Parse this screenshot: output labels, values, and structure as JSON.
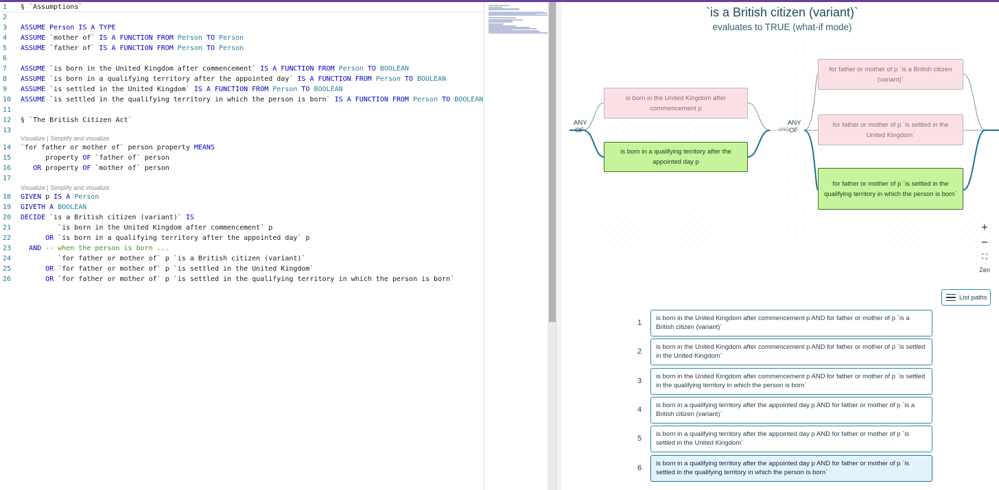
{
  "editor": {
    "lines": [
      {
        "n": "1",
        "tokens": [
          {
            "t": "§ `Assumptions`",
            "c": ""
          }
        ]
      },
      {
        "n": "2",
        "tokens": []
      },
      {
        "n": "3",
        "tokens": [
          {
            "t": "ASSUME Person ",
            "c": "kw"
          },
          {
            "t": "IS A TYPE",
            "c": "kw"
          }
        ]
      },
      {
        "n": "4",
        "tokens": [
          {
            "t": "ASSUME ",
            "c": "kw"
          },
          {
            "t": "`mother of` ",
            "c": ""
          },
          {
            "t": "IS A FUNCTION FROM ",
            "c": "kw"
          },
          {
            "t": "Person",
            "c": "ty"
          },
          {
            "t": " TO ",
            "c": "kw"
          },
          {
            "t": "Person",
            "c": "ty"
          }
        ]
      },
      {
        "n": "5",
        "tokens": [
          {
            "t": "ASSUME ",
            "c": "kw"
          },
          {
            "t": "`father of` ",
            "c": ""
          },
          {
            "t": "IS A FUNCTION FROM ",
            "c": "kw"
          },
          {
            "t": "Person",
            "c": "ty"
          },
          {
            "t": " TO ",
            "c": "kw"
          },
          {
            "t": "Person",
            "c": "ty"
          }
        ]
      },
      {
        "n": "6",
        "tokens": []
      },
      {
        "n": "7",
        "tokens": [
          {
            "t": "ASSUME ",
            "c": "kw"
          },
          {
            "t": "`is born in the United Kingdom after commencement` ",
            "c": ""
          },
          {
            "t": "IS A FUNCTION FROM ",
            "c": "kw"
          },
          {
            "t": "Person",
            "c": "ty"
          },
          {
            "t": " TO ",
            "c": "kw"
          },
          {
            "t": "BOOLEAN",
            "c": "ty"
          }
        ]
      },
      {
        "n": "8",
        "tokens": [
          {
            "t": "ASSUME ",
            "c": "kw"
          },
          {
            "t": "`is born in a qualifying territory after the appointed day` ",
            "c": ""
          },
          {
            "t": "IS A FUNCTION FROM ",
            "c": "kw"
          },
          {
            "t": "Person",
            "c": "ty"
          },
          {
            "t": " TO ",
            "c": "kw"
          },
          {
            "t": "BOOLEAN",
            "c": "ty"
          }
        ]
      },
      {
        "n": "9",
        "tokens": [
          {
            "t": "ASSUME ",
            "c": "kw"
          },
          {
            "t": "`is settled in the United Kingdom` ",
            "c": ""
          },
          {
            "t": "IS A FUNCTION FROM ",
            "c": "kw"
          },
          {
            "t": "Person",
            "c": "ty"
          },
          {
            "t": " TO ",
            "c": "kw"
          },
          {
            "t": "BOOLEAN",
            "c": "ty"
          }
        ]
      },
      {
        "n": "10",
        "tokens": [
          {
            "t": "ASSUME ",
            "c": "kw"
          },
          {
            "t": "`is settled in the qualifying territory in which the person is born` ",
            "c": ""
          },
          {
            "t": "IS A FUNCTION FROM ",
            "c": "kw"
          },
          {
            "t": "Person",
            "c": "ty"
          },
          {
            "t": " TO ",
            "c": "kw"
          },
          {
            "t": "BOOLEAN",
            "c": "ty"
          }
        ]
      },
      {
        "n": "11",
        "tokens": []
      },
      {
        "n": "12",
        "tokens": [
          {
            "t": "§ `The British Citizen Act`",
            "c": ""
          }
        ]
      },
      {
        "n": "13",
        "tokens": []
      },
      {
        "n": "14",
        "tokens": [
          {
            "t": "`for father or mother of` person property ",
            "c": ""
          },
          {
            "t": "MEANS",
            "c": "kw"
          }
        ]
      },
      {
        "n": "15",
        "tokens": [
          {
            "t": "      property ",
            "c": ""
          },
          {
            "t": "OF",
            "c": "kw"
          },
          {
            "t": " `father of` person",
            "c": ""
          }
        ]
      },
      {
        "n": "16",
        "tokens": [
          {
            "t": "   ",
            "c": ""
          },
          {
            "t": "OR",
            "c": "kw"
          },
          {
            "t": " property ",
            "c": ""
          },
          {
            "t": "OF",
            "c": "kw"
          },
          {
            "t": " `mother of` person",
            "c": ""
          }
        ]
      },
      {
        "n": "17",
        "tokens": []
      },
      {
        "n": "18",
        "tokens": [
          {
            "t": "GIVEN",
            "c": "kw"
          },
          {
            "t": " p ",
            "c": ""
          },
          {
            "t": "IS A ",
            "c": "kw"
          },
          {
            "t": "Person",
            "c": "ty"
          }
        ]
      },
      {
        "n": "19",
        "tokens": [
          {
            "t": "GIVETH A ",
            "c": "kw"
          },
          {
            "t": "BOOLEAN",
            "c": "ty"
          }
        ]
      },
      {
        "n": "20",
        "tokens": [
          {
            "t": "DECIDE",
            "c": "kw"
          },
          {
            "t": " `is a British citizen (variant)` ",
            "c": ""
          },
          {
            "t": "IS",
            "c": "kw"
          }
        ]
      },
      {
        "n": "21",
        "tokens": [
          {
            "t": "         `is born in the United Kingdom after commencement` p",
            "c": ""
          }
        ]
      },
      {
        "n": "22",
        "tokens": [
          {
            "t": "      ",
            "c": ""
          },
          {
            "t": "OR",
            "c": "kw"
          },
          {
            "t": " `is born in a qualifying territory after the appointed day` p",
            "c": ""
          }
        ]
      },
      {
        "n": "23",
        "tokens": [
          {
            "t": "  ",
            "c": ""
          },
          {
            "t": "AND",
            "c": "kw"
          },
          {
            "t": " -- when the person is born ...",
            "c": "cm"
          }
        ]
      },
      {
        "n": "24",
        "tokens": [
          {
            "t": "         `for father or mother of` p `is a British citizen (variant)`",
            "c": ""
          }
        ]
      },
      {
        "n": "25",
        "tokens": [
          {
            "t": "      ",
            "c": ""
          },
          {
            "t": "OR",
            "c": "kw"
          },
          {
            "t": " `for father or mother of` p `is settled in the United Kingdom`",
            "c": ""
          }
        ]
      },
      {
        "n": "26",
        "tokens": [
          {
            "t": "      ",
            "c": ""
          },
          {
            "t": "OR",
            "c": "kw"
          },
          {
            "t": " `for father or mother of` p `is settled in the qualifying territory in which the person is born`",
            "c": ""
          }
        ]
      }
    ],
    "codelens": [
      "Visualize | Simplify and visualize",
      "Visualize | Simplify and visualize"
    ]
  },
  "visualizer": {
    "title": "`is a British citizen (variant)`",
    "subtitle": "evaluates to TRUE (what-if mode)",
    "gates": {
      "any1": "ANY",
      "of1": "OF",
      "and": "AND",
      "any2": "ANY",
      "of2": "OF"
    },
    "nodes": [
      {
        "label": "is born in the United Kingdom after commencement p",
        "value": "false"
      },
      {
        "label": "is born in a qualifying territory after the appointed day p",
        "value": "true"
      },
      {
        "label": "for father or mother of p `is a British citizen (variant)`",
        "value": "false"
      },
      {
        "label": "for father or mother of p `is settled in the United Kingdom`",
        "value": "false"
      },
      {
        "label": "for father or mother of p `is settled in the qualifying territory in which the person is born`",
        "value": "true"
      }
    ],
    "controls": {
      "zoom_in": "+",
      "zoom_out": "−",
      "fit": "⛶",
      "zen": "Zen"
    },
    "list_paths_label": "List paths",
    "paths": [
      {
        "num": "1",
        "text": "is born in the United Kingdom after commencement p AND for father or mother of p `is a British citizen (variant)`"
      },
      {
        "num": "2",
        "text": "is born in the United Kingdom after commencement p AND for father or mother of p `is settled in the United Kingdom`"
      },
      {
        "num": "3",
        "text": "is born in the United Kingdom after commencement p AND for father or mother of p `is settled in the qualifying territory in which the person is born`"
      },
      {
        "num": "4",
        "text": "is born in a qualifying territory after the appointed day p AND for father or mother of p `is a British citizen (variant)`"
      },
      {
        "num": "5",
        "text": "is born in a qualifying territory after the appointed day p AND for father or mother of p `is settled in the United Kingdom`"
      },
      {
        "num": "6",
        "text": "is born in a qualifying territory after the appointed day p AND for father or mother of p `is settled in the qualifying territory in which the person is born`",
        "selected": true
      }
    ]
  },
  "colors": {
    "accent": "#6a3fa0",
    "true_node": "#c6f39c",
    "false_node": "#fbe1e5",
    "path_border": "#2a8aa8"
  }
}
